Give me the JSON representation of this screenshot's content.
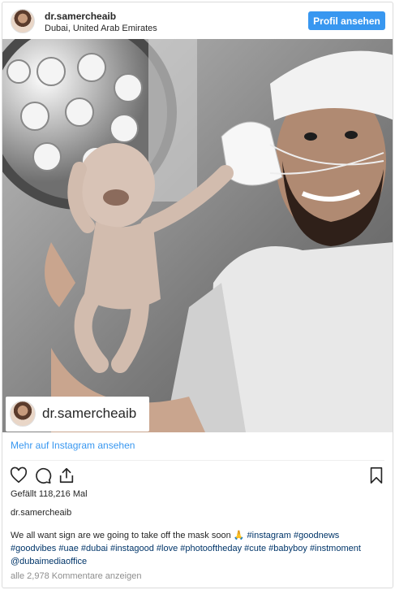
{
  "header": {
    "username": "dr.samercheaib",
    "location": "Dubai, United Arab Emirates",
    "profile_button": "Profil ansehen"
  },
  "photo": {
    "overlay_username": "dr.samercheaib",
    "icon": "newborn-photo"
  },
  "view_more": "Mehr auf Instagram ansehen",
  "actions": {
    "like_icon": "heart-icon",
    "comment_icon": "comment-icon",
    "share_icon": "share-icon",
    "save_icon": "bookmark-icon"
  },
  "likes": "Gefällt 118,216 Mal",
  "caption": {
    "username": "dr.samercheaib",
    "text": "We all want sign are we going to take off the mask soon 🙏",
    "hashtags": [
      "#instagram",
      "#goodnews",
      "#goodvibes",
      "#uae",
      "#dubai",
      "#instagood",
      "#love",
      "#photooftheday",
      "#cute",
      "#babyboy",
      "#instmoment",
      "@dubaimediaoffice"
    ]
  },
  "comments": "alle 2,978 Kommentare anzeigen",
  "colors": {
    "accent": "#3897f0",
    "hashtag": "#003569",
    "muted": "#8e8e8e"
  }
}
